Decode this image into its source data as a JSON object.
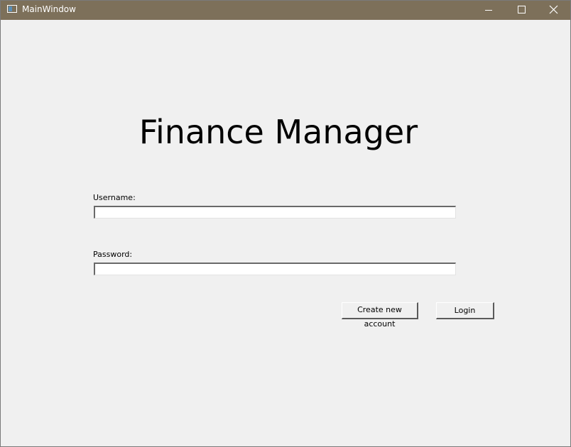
{
  "window": {
    "title": "MainWindow",
    "titlebar_color": "#7d705a"
  },
  "controls": {
    "minimize_icon": "minimize-icon",
    "maximize_icon": "maximize-icon",
    "close_icon": "close-icon"
  },
  "main": {
    "heading": "Finance Manager",
    "username_label": "Username:",
    "username_value": "",
    "password_label": "Password:",
    "password_value": "",
    "create_account_label": "Create new account",
    "login_label": "Login"
  }
}
